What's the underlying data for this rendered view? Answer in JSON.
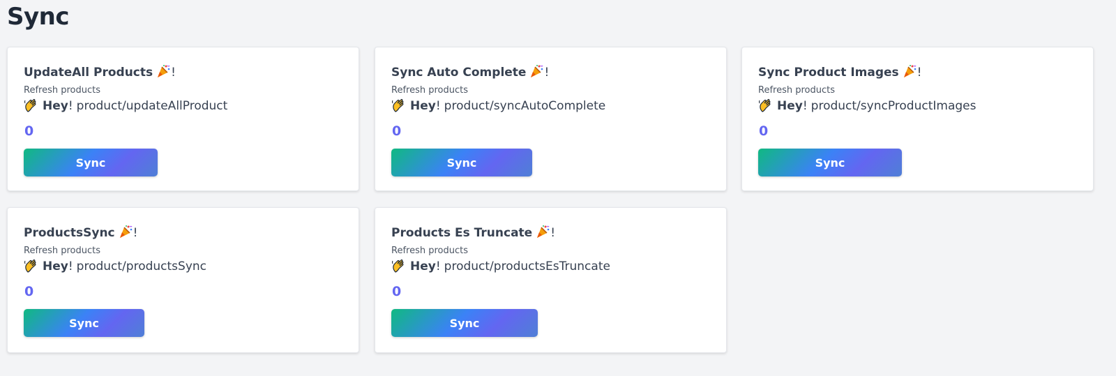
{
  "page": {
    "title": "Sync"
  },
  "cards": [
    {
      "title": "UpdateAll Products",
      "title_suffix": "!",
      "subtitle": "Refresh products",
      "greeting_bold": "Hey",
      "greeting_excl": "!",
      "endpoint": "product/updateAllProduct",
      "count": "0",
      "button_label": "Sync"
    },
    {
      "title": "Sync Auto Complete",
      "title_suffix": "!",
      "subtitle": "Refresh products",
      "greeting_bold": "Hey",
      "greeting_excl": "!",
      "endpoint": "product/syncAutoComplete",
      "count": "0",
      "button_label": "Sync"
    },
    {
      "title": "Sync Product Images",
      "title_suffix": "!",
      "subtitle": "Refresh products",
      "greeting_bold": "Hey",
      "greeting_excl": "!",
      "endpoint": "product/syncProductImages",
      "count": "0",
      "button_label": "Sync"
    },
    {
      "title": "ProductsSync",
      "title_suffix": "!",
      "subtitle": "Refresh products",
      "greeting_bold": "Hey",
      "greeting_excl": "!",
      "endpoint": "product/productsSync",
      "count": "0",
      "button_label": "Sync"
    },
    {
      "title": "Products Es Truncate",
      "title_suffix": "!",
      "subtitle": "Refresh products",
      "greeting_bold": "Hey",
      "greeting_excl": "!",
      "endpoint": "product/productsEsTruncate",
      "count": "0",
      "button_label": "Sync"
    }
  ],
  "icons": {
    "title_icon": "party-popper-icon",
    "greeting_icon": "waving-hand-icon"
  },
  "colors": {
    "accent": "#6366f1",
    "button_gradient_start": "#10b981",
    "button_gradient_end": "#6366f1",
    "background": "#f3f4f6"
  }
}
